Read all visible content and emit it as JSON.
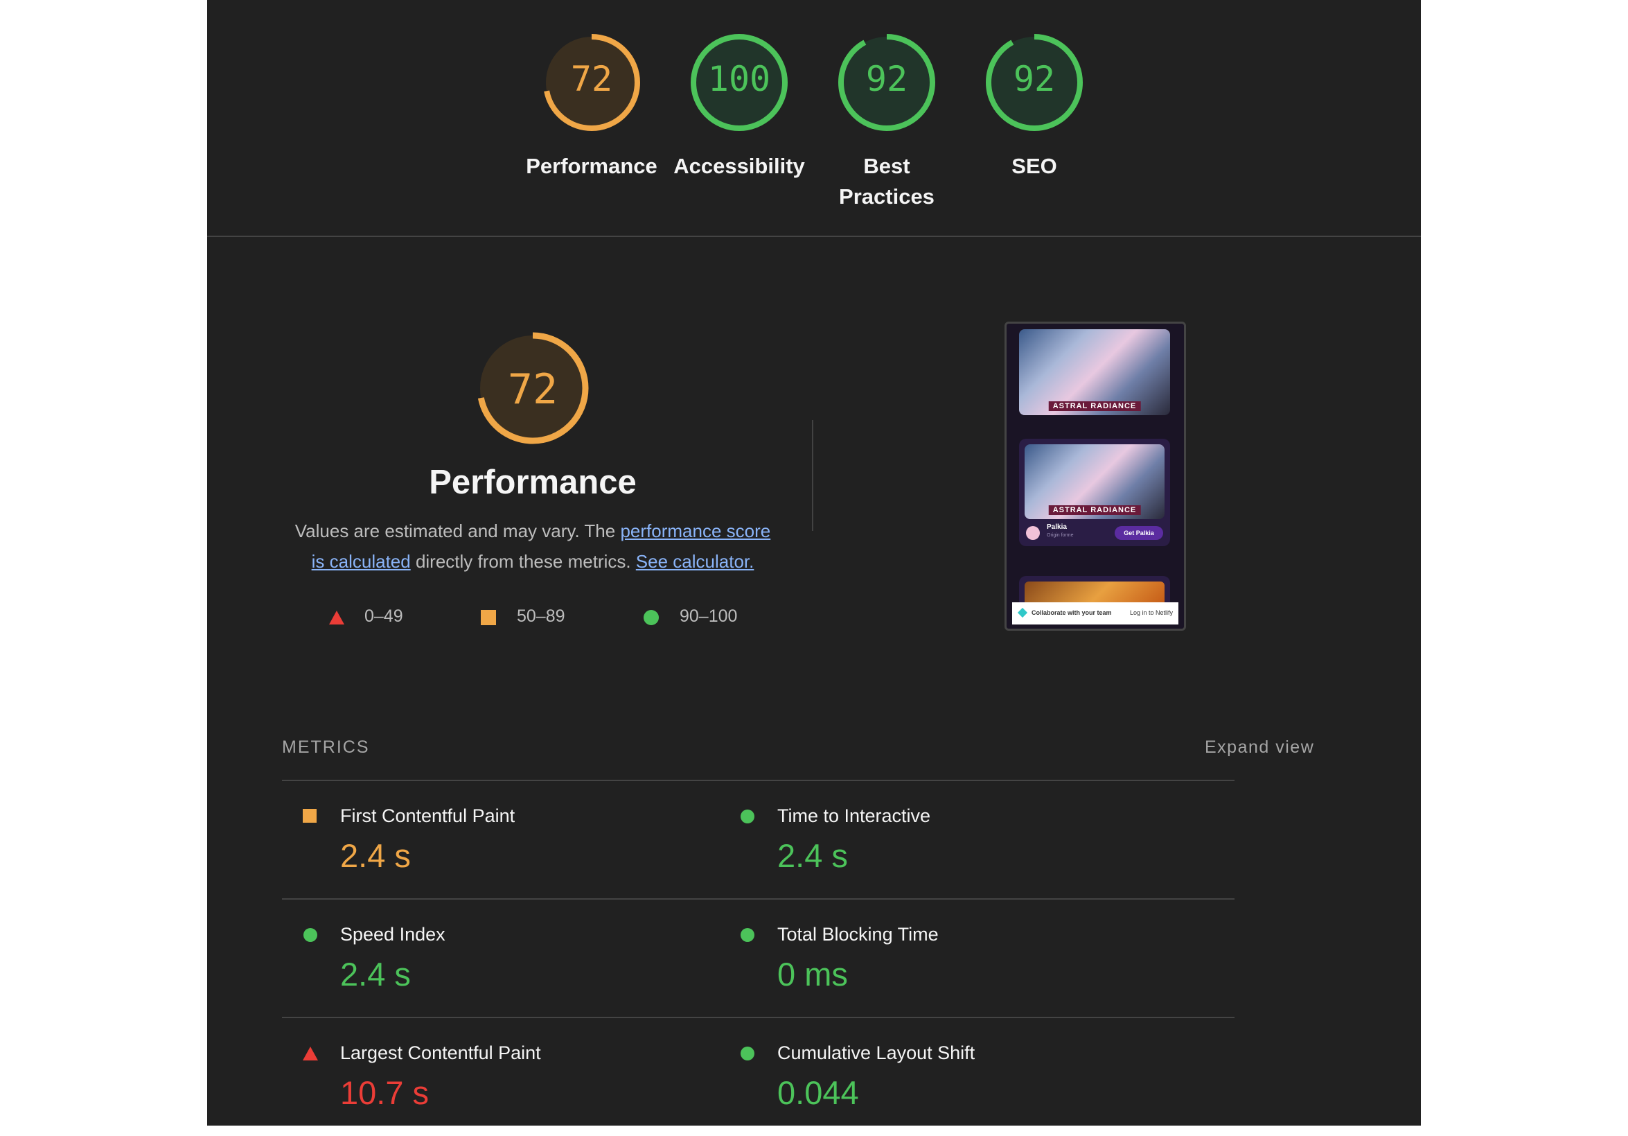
{
  "colors": {
    "average": "#f0a747",
    "pass": "#4cc35a",
    "fail": "#eb3d37",
    "average_bg": "#3a2f20",
    "pass_bg": "#21352a"
  },
  "top_scores": [
    {
      "score": 72,
      "label": "Performance",
      "rating": "average"
    },
    {
      "score": 100,
      "label": "Accessibility",
      "rating": "pass"
    },
    {
      "score": 92,
      "label": "Best Practices",
      "rating": "pass"
    },
    {
      "score": 92,
      "label": "SEO",
      "rating": "pass"
    }
  ],
  "performance": {
    "score": 72,
    "rating": "average",
    "title": "Performance",
    "desc_prefix": "Values are estimated and may vary. The ",
    "desc_link1": "performance score is calculated",
    "desc_middle": " directly from these metrics. ",
    "desc_link2": "See calculator."
  },
  "legend": [
    {
      "range": "0–49",
      "icon": "triangle-icon",
      "rating": "fail"
    },
    {
      "range": "50–89",
      "icon": "square-icon",
      "rating": "average"
    },
    {
      "range": "90–100",
      "icon": "circle-icon",
      "rating": "pass"
    }
  ],
  "thumbnail": {
    "banner_text": "ASTRAL RADIANCE",
    "card_name": "Palkia",
    "card_sub": "Origin forme",
    "card_button": "Get Palkia",
    "footer_left": "Collaborate with your team",
    "footer_right": "Log in to Netlify"
  },
  "metrics_heading": "METRICS",
  "expand_view": "Expand view",
  "metrics": [
    {
      "name": "First Contentful Paint",
      "value": "2.4 s",
      "rating": "average",
      "icon": "square-icon"
    },
    {
      "name": "Time to Interactive",
      "value": "2.4 s",
      "rating": "pass",
      "icon": "circle-icon"
    },
    {
      "name": "Speed Index",
      "value": "2.4 s",
      "rating": "pass",
      "icon": "circle-icon"
    },
    {
      "name": "Total Blocking Time",
      "value": "0 ms",
      "rating": "pass",
      "icon": "circle-icon"
    },
    {
      "name": "Largest Contentful Paint",
      "value": "10.7 s",
      "rating": "fail",
      "icon": "triangle-icon"
    },
    {
      "name": "Cumulative Layout Shift",
      "value": "0.044",
      "rating": "pass",
      "icon": "circle-icon"
    }
  ]
}
